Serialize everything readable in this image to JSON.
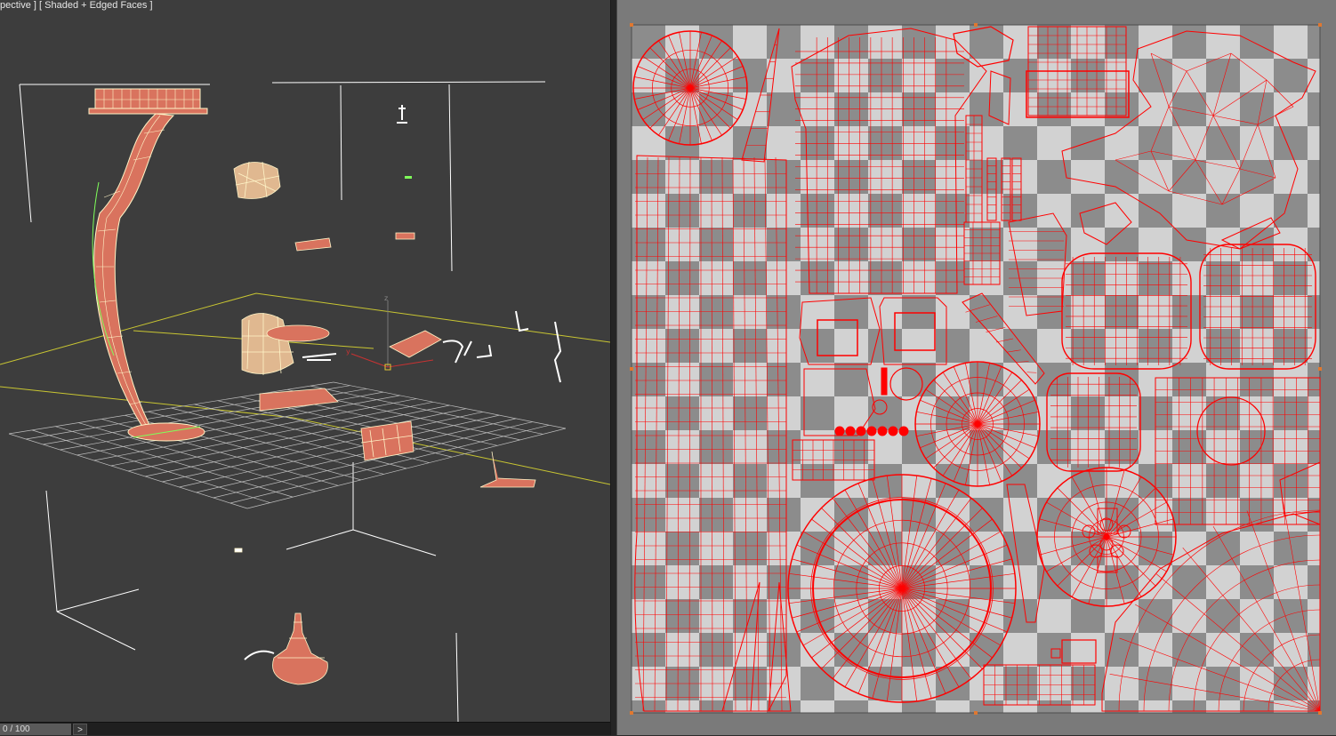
{
  "viewport": {
    "label": "pective ] [ Shaded + Edged Faces ]"
  },
  "timeline": {
    "frame": "0 / 100",
    "next_label": ">"
  },
  "colors": {
    "uv_wire": "#ff0000",
    "checker_light": "#d2d2d2",
    "checker_dark": "#8c8c8c",
    "mesh_face": "#d9735e",
    "mesh_edge": "#fff5c8",
    "selection_edge": "#7fff5a"
  },
  "icons": {
    "next_frame": "next-frame-arrow-icon",
    "pivot": "pivot-gizmo-icon"
  }
}
